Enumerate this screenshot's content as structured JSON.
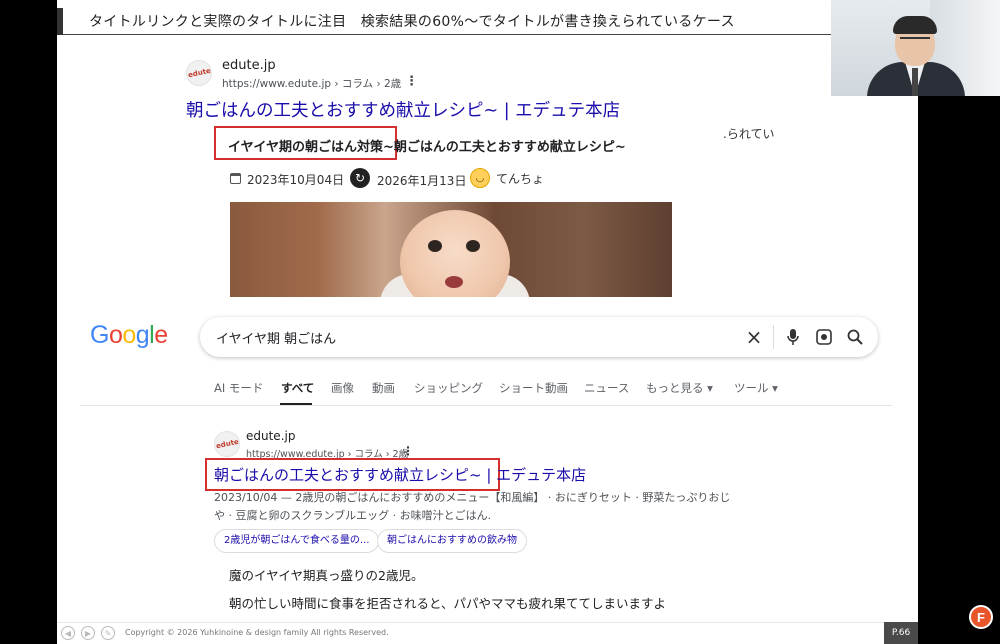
{
  "header": {
    "title": "タイトルリンクと実際のタイトルに注目　検索結果の60%〜でタイトルが書き換えられているケース"
  },
  "top_result": {
    "favicon_text": "edute",
    "site_name": "edute.jp",
    "url": "https://www.edute.jp › コラム › 2歳",
    "menu_glyph": "⋮",
    "title": "朝ごはんの工夫とおすすめ献立レシピ~ | エデュテ本店",
    "page_title": "イヤイヤ期の朝ごはん対策~朝ごはんの工夫とおすすめ献立レシピ~",
    "stray_text": ".られてい",
    "published": "2023年10月04日",
    "updated": "2026年1月13日",
    "author": "てんちょ"
  },
  "google": {
    "logo_letters": [
      {
        "ch": "G",
        "color": "#4285F4"
      },
      {
        "ch": "o",
        "color": "#EA4335"
      },
      {
        "ch": "o",
        "color": "#FBBC05"
      },
      {
        "ch": "g",
        "color": "#4285F4"
      },
      {
        "ch": "l",
        "color": "#34A853"
      },
      {
        "ch": "e",
        "color": "#EA4335"
      }
    ],
    "query": "イヤイヤ期 朝ごはん",
    "tabs": [
      "AI モード",
      "すべて",
      "画像",
      "動画",
      "ショッピング",
      "ショート動画",
      "ニュース",
      "もっと見る ▾",
      "ツール ▾"
    ],
    "active_tab": "すべて"
  },
  "bottom_result": {
    "favicon_text": "edute",
    "site_name": "edute.jp",
    "url": "https://www.edute.jp › コラム › 2歳",
    "menu_glyph": "⋮",
    "title": "朝ごはんの工夫とおすすめ献立レシピ~ | エデュテ本店",
    "snippet_line1": "2023/10/04 — 2歳児の朝ごはんにおすすめのメニュー【和風編】 · おにぎりセット · 野菜たっぷりおじ",
    "snippet_line2": "や · 豆腐と卵のスクランブルエッグ · お味噌汁とごはん.",
    "chips": [
      "2歳児が朝ごはんで食べる量の...",
      "朝ごはんにおすすめの飲み物"
    ],
    "body_line1": "魔のイヤイヤ期真っ盛りの2歳児。",
    "body_line2": "朝の忙しい時間に食事を拒否されると、パパやママも疲れ果ててしまいますよ"
  },
  "footer": {
    "copyright": "Copyright © 2026 Yuhkinoine & design family  All rights Reserved.",
    "page": "P.66",
    "brand_letter": "F"
  }
}
